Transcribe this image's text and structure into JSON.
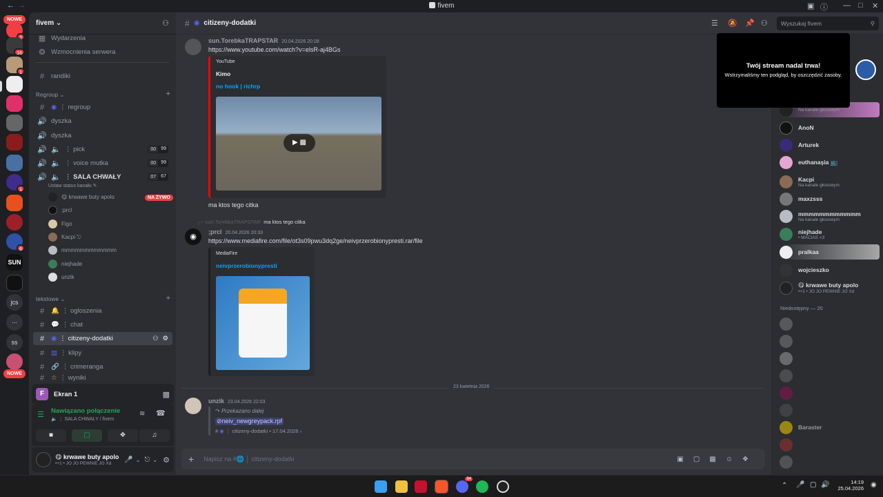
{
  "window": {
    "title": "fivem"
  },
  "rail": {
    "nowe_top": "NOWE",
    "nowe_bottom": "NOWE",
    "badges": [
      "2",
      "16",
      "1",
      "1",
      "6"
    ],
    "text_servers": [
      "jcs",
      "...",
      "ss"
    ]
  },
  "guild": {
    "name": "fivem",
    "events": "Wydarzenia",
    "boosts": "Wzmocnienia serwera",
    "channels_top": [
      "randiki"
    ],
    "cat_regroup": "Regroup",
    "regroup_channels": [
      "regroup",
      "dyszka",
      "dyszka",
      "pick",
      "voice mutka",
      "SALA CHWAŁY"
    ],
    "counts": {
      "pick": [
        "00",
        "99"
      ],
      "voice_mutka": [
        "00",
        "99"
      ],
      "sala": [
        "07",
        "67"
      ]
    },
    "set_status": "Ustaw status kanału",
    "voice_users": [
      "😋 krwawe buty apolo",
      ";prcl",
      "Figo",
      "Kacpi",
      "mmmmmmmmmmmm",
      "niejhade",
      "unzik"
    ],
    "live": "NA ŻYWO",
    "cat_text": "tekstowe",
    "text_channels": [
      "ogloszenia",
      "chat",
      "citizeny-dodatki",
      "klipy",
      "crimeranga",
      "wyniki"
    ]
  },
  "voice_panel": {
    "screen_letter": "F",
    "screen_title": "Ekran 1",
    "connected": "Nawiązano połączenie",
    "connected_sub": "SALA CHWAŁY / fivem",
    "username": "😋 krwawe buty apolo",
    "user_status": "•+1 • JO JO PEWNIE JO Xd"
  },
  "channel": {
    "name": "citizeny-dodatki",
    "search_placeholder": "Wyszukaj fivem"
  },
  "messages": [
    {
      "author": "sun.TorebkaTRAPSTAR",
      "time": "20.04.2026 20:28",
      "link": "https://www.youtube.com/watch?v=elsR-aj4BGs",
      "embed_provider": "YouTube",
      "embed_author": "Kimo",
      "embed_title": "no hook | richrp",
      "text": "ma ktos tego citka"
    },
    {
      "reply_author": "sun.TorebkaTRAPSTAR",
      "reply_text": "ma ktos tego citka",
      "author": ";prcl",
      "time": "20.04.2026 20:33",
      "link": "https://www.mediafire.com/file/ot3s09pwu3dq2ge/neivprzerobionypresti.rar/file",
      "embed_provider": "MediaFire",
      "embed_title": "neivprzerobionypresti"
    },
    {
      "divider": "23 kwietnia 2026",
      "author": "unzik",
      "time": "23.04.2026 22:03",
      "forwarded": "Przekazano dalej",
      "file": "neiv_newgreypack.rpf",
      "source": "citizeny-dodatki • 17.04.2026 ›"
    }
  ],
  "composer": {
    "placeholder": "Napisz na #🌐 │ citizeny-dodatki"
  },
  "stream_popup": {
    "title": "Twój stream nadal trwa!",
    "body": "Wstrzymaliśmy ten podgląd, by oszczędzić zasoby."
  },
  "members": {
    "online": [
      {
        "name": "",
        "sub": "Na kanale głosowym"
      },
      {
        "name": "AnoN",
        "sub": ""
      },
      {
        "name": "Arturek",
        "sub": ""
      },
      {
        "name": "euthanaşia 📺",
        "sub": ""
      },
      {
        "name": "Kacpi",
        "sub": "Na kanale głosowym"
      },
      {
        "name": "maxzsss",
        "sub": ""
      },
      {
        "name": "mmmmmmmmmmmm",
        "sub": "Na kanale głosowym"
      },
      {
        "name": "niejhade",
        "sub": "• MACIAS <3"
      },
      {
        "name": "pralkaa",
        "sub": ""
      },
      {
        "name": "wojcieszko",
        "sub": ""
      },
      {
        "name": "😋 krwawe buty apolo",
        "sub": "•+1 • JO JO PEWNIE JO Xd"
      }
    ],
    "offline_header": "Niedostępny — 20",
    "offline": [
      "",
      "",
      "",
      "",
      "",
      "",
      "Baraster",
      "",
      ""
    ]
  },
  "taskbar": {
    "time": "14:19",
    "date": "25.04.2026",
    "discord_badge": "94"
  },
  "colors": {
    "accent": "#5865f2",
    "online": "#23a559",
    "live": "#f23f43",
    "link": "#00a8fc"
  }
}
